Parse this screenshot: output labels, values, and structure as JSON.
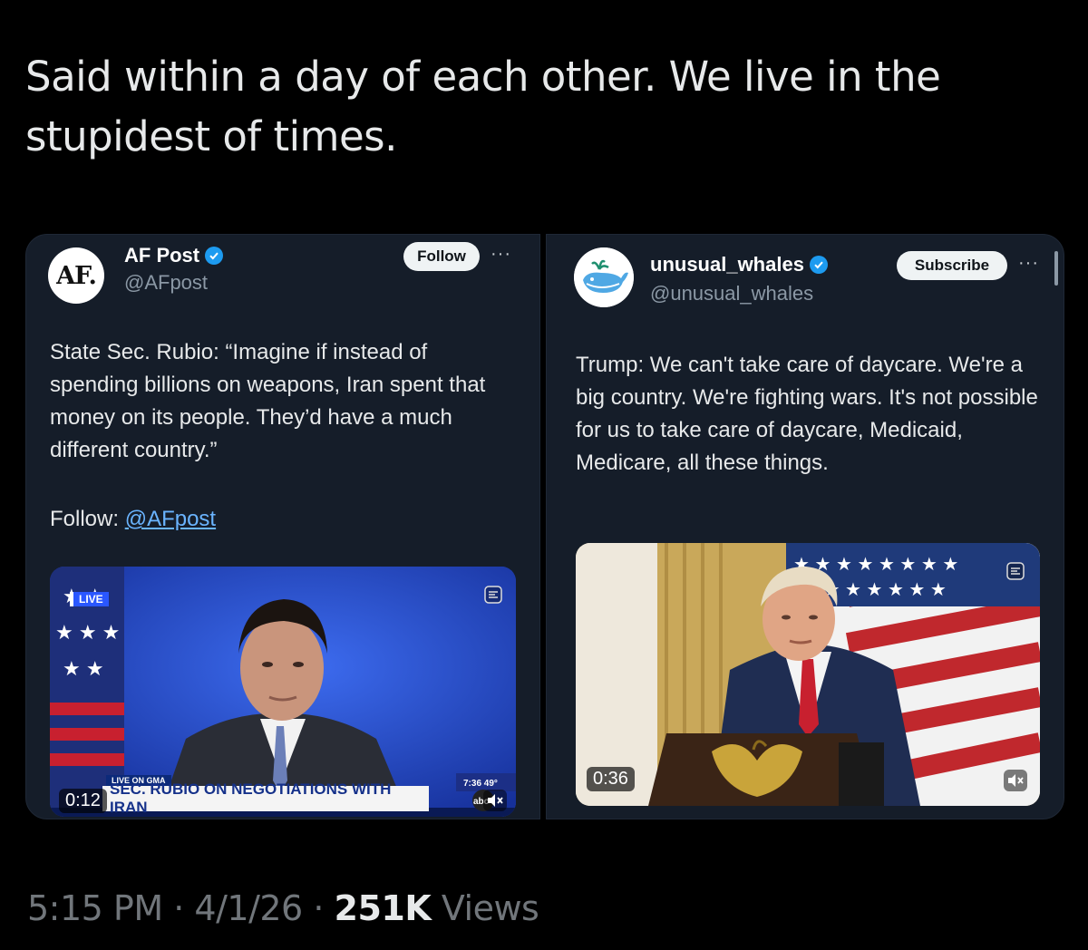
{
  "tweet": {
    "text": "Said within a day of each other. We live in the stupidest of times.",
    "time": "5:15 PM",
    "date": "4/1/26",
    "views_count": "251K",
    "views_label": "Views"
  },
  "left_post": {
    "avatar_text": "AF.",
    "name": "AF Post",
    "handle": "@AFpost",
    "button_label": "Follow",
    "more": "···",
    "body": "State Sec. Rubio: “Imagine if instead of spending billions on weapons, Iran spent that money on its people. They’d have a much different country.”",
    "follow_prefix": "Follow:",
    "follow_link": "@AFpost",
    "video": {
      "duration": "0:12",
      "live_tag": "LIVE",
      "caption_small": "LIVE ON GMA",
      "caption": "SEC. RUBIO ON NEGOTIATIONS WITH IRAN",
      "time_badge": "7:36 49°",
      "network": "abc"
    }
  },
  "right_post": {
    "name": "unusual_whales",
    "handle": "@unusual_whales",
    "button_label": "Subscribe",
    "more": "···",
    "body": "Trump: We can't take care of daycare. We're a big country. We're fighting wars. It's not possible for us to take care of daycare, Medicaid, Medicare, all these things.",
    "video": {
      "duration": "0:36"
    }
  },
  "colors": {
    "background": "#000000",
    "card": "#151d29",
    "verified": "#1d9bf0",
    "link": "#6ab4ff"
  }
}
